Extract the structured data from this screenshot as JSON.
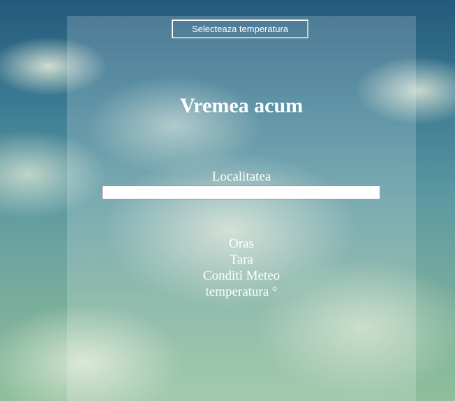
{
  "header": {
    "temperature_button_label": "Selecteaza temperatura"
  },
  "main": {
    "title": "Vremea acum",
    "location_label": "Localitatea",
    "location_value": "",
    "city_label": "Oras",
    "country_label": "Tara",
    "conditions_label": "Conditi Meteo",
    "temperature_label": "temperatura °"
  }
}
